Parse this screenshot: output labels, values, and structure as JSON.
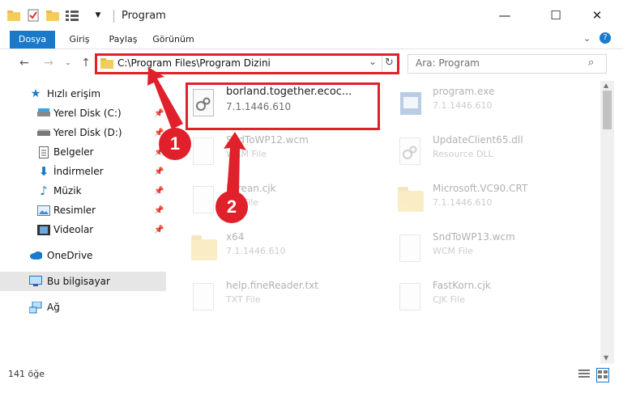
{
  "window": {
    "title": "Program",
    "controls": {
      "minimize": "—",
      "maximize": "☐",
      "close": "✕"
    }
  },
  "ribbon": {
    "tabs": [
      "Dosya",
      "Giriş",
      "Paylaş",
      "Görünüm"
    ]
  },
  "address": {
    "path": "C:\\Program Files\\Program Dizini",
    "search_placeholder": "Ara: Program"
  },
  "nav": {
    "items": [
      {
        "label": "Hızlı erişim",
        "icon": "star-icon",
        "pinned": false
      },
      {
        "label": "Yerel Disk (C:)",
        "icon": "drive-icon",
        "pinned": true
      },
      {
        "label": "Yerel Disk (D:)",
        "icon": "drive-icon",
        "pinned": true
      },
      {
        "label": "Belgeler",
        "icon": "documents-icon",
        "pinned": true
      },
      {
        "label": "İndirmeler",
        "icon": "download-icon",
        "pinned": true
      },
      {
        "label": "Müzik",
        "icon": "music-icon",
        "pinned": true
      },
      {
        "label": "Resimler",
        "icon": "pictures-icon",
        "pinned": true
      },
      {
        "label": "Videolar",
        "icon": "video-icon",
        "pinned": true
      },
      {
        "label": "OneDrive",
        "icon": "cloud-icon",
        "pinned": false
      },
      {
        "label": "Bu bilgisayar",
        "icon": "computer-icon",
        "pinned": false,
        "selected": true
      },
      {
        "label": "Ağ",
        "icon": "network-icon",
        "pinned": false
      }
    ]
  },
  "files": [
    {
      "name": "borland.together.ecoc...",
      "sub": "7.1.1446.610",
      "type": "dll",
      "selected": true
    },
    {
      "name": "program.exe",
      "sub": "7.1.1446.610",
      "type": "exe"
    },
    {
      "name": "SndToWP12.wcm",
      "sub": "WCM File",
      "type": "doc"
    },
    {
      "name": "UpdateClient65.dll",
      "sub": "Resource DLL",
      "type": "dll"
    },
    {
      "name": "korean.cjk",
      "sub": "CJK File",
      "type": "doc"
    },
    {
      "name": "Microsoft.VC90.CRT",
      "sub": "7.1.1446.610",
      "type": "folder"
    },
    {
      "name": "x64",
      "sub": "7.1.1446.610",
      "type": "folder"
    },
    {
      "name": "SndToWP13.wcm",
      "sub": "WCM File",
      "type": "doc"
    },
    {
      "name": "help.fineReader.txt",
      "sub": "TXT File",
      "type": "doc"
    },
    {
      "name": "FastKorn.cjk",
      "sub": "CJK File",
      "type": "doc"
    }
  ],
  "status": {
    "item_count": "141 öğe"
  },
  "callouts": {
    "first": "1",
    "second": "2"
  },
  "colors": {
    "accent": "#1979ca",
    "highlight": "#e0202a",
    "folder": "#f3cd5b"
  }
}
